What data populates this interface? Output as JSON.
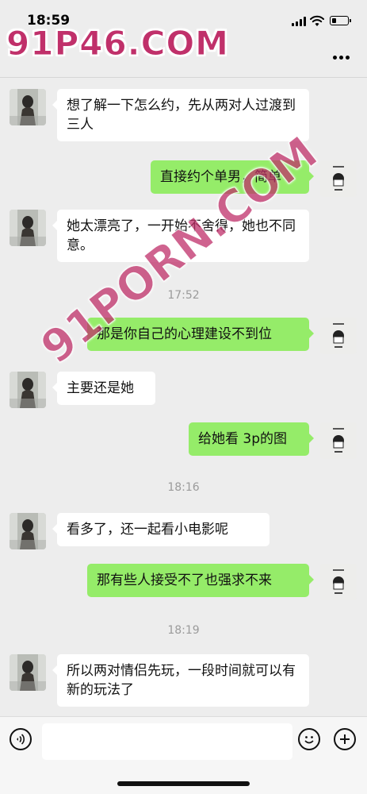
{
  "status_bar": {
    "time": "18:59"
  },
  "watermarks": {
    "top": "91P46.COM",
    "diagonal": "91PORN.COM"
  },
  "messages": [
    {
      "side": "in",
      "text": "想了解一下怎么约，先从两对人过渡到三人"
    },
    {
      "side": "out",
      "text": "直接约个单男，简单"
    },
    {
      "side": "in",
      "text": "她太漂亮了，一开始不舍得，她也不同意。"
    },
    {
      "side": "time",
      "text": "17:52"
    },
    {
      "side": "out",
      "text": "那是你自己的心理建设不到位"
    },
    {
      "side": "in",
      "text": "主要还是她"
    },
    {
      "side": "out",
      "text": "给她看 3p的图"
    },
    {
      "side": "time",
      "text": "18:16"
    },
    {
      "side": "in",
      "text": "看多了，还一起看小电影呢"
    },
    {
      "side": "out",
      "text": "那有些人接受不了也强求不来"
    },
    {
      "side": "time",
      "text": "18:19"
    },
    {
      "side": "in",
      "text": "所以两对情侣先玩，一段时间就可以有新的玩法了"
    }
  ],
  "icons": {
    "signal": "signal-icon",
    "wifi": "wifi-icon",
    "battery": "battery-icon",
    "more": "more-icon",
    "voice": "voice-icon",
    "emoji": "emoji-icon",
    "plus": "plus-icon"
  },
  "colors": {
    "outgoing_bubble": "#95ec69",
    "incoming_bubble": "#ffffff",
    "background": "#ededed",
    "watermark": "#c0306a"
  }
}
